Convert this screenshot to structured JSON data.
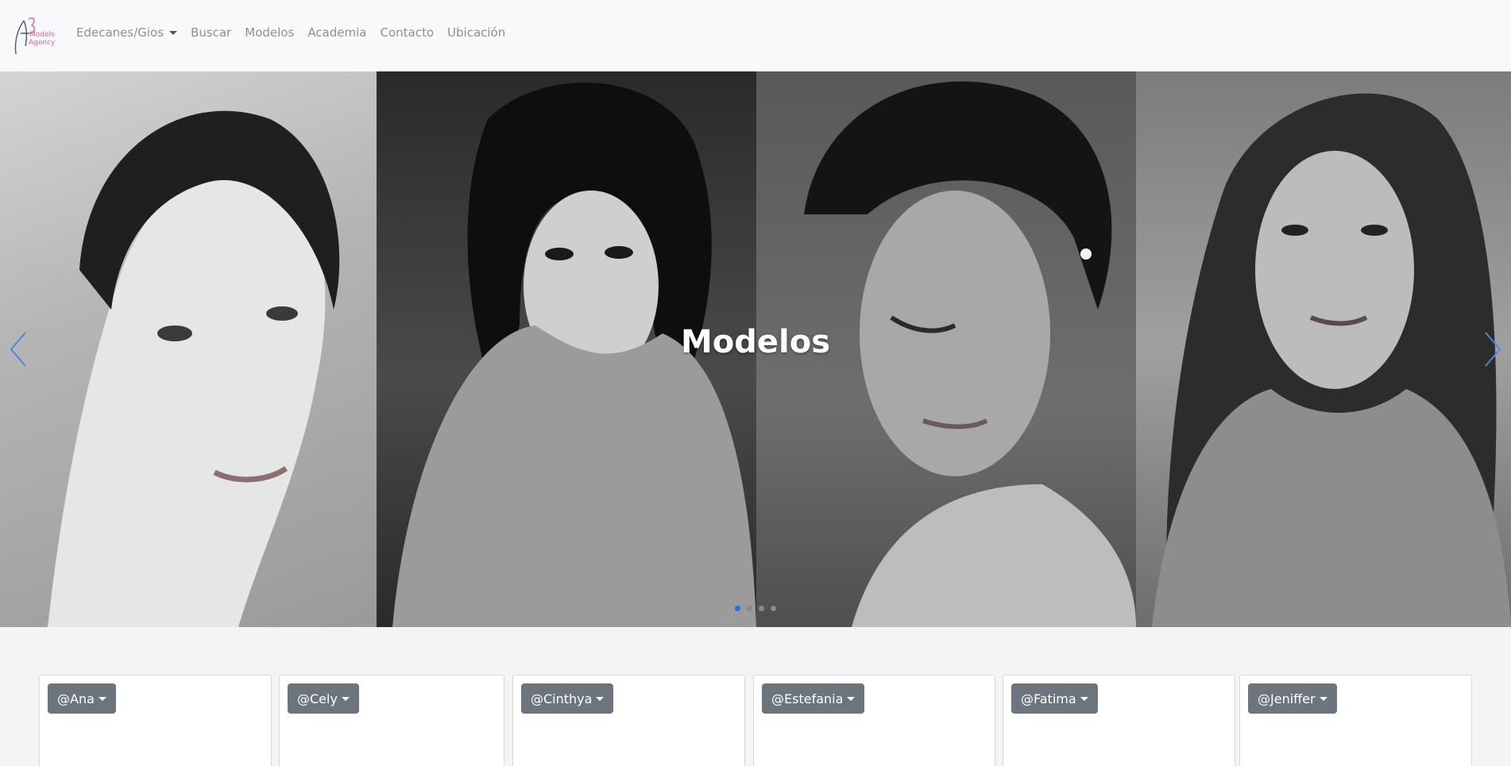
{
  "brand": {
    "logo_text_line1": "Models",
    "logo_text_line2": "Agency",
    "accent_color": "#e3608f"
  },
  "nav": {
    "items": [
      {
        "label": "Edecanes/Gios",
        "dropdown": true
      },
      {
        "label": "Buscar"
      },
      {
        "label": "Modelos"
      },
      {
        "label": "Academia"
      },
      {
        "label": "Contacto"
      },
      {
        "label": "Ubicación"
      }
    ]
  },
  "carousel": {
    "caption": "Modelos",
    "prev_icon": "chevron-left-icon",
    "next_icon": "chevron-right-icon",
    "slide_count": 4,
    "active_slide": 1,
    "indicator_active_color": "#1a73e8"
  },
  "models": [
    {
      "handle": "@Ana"
    },
    {
      "handle": "@Cely"
    },
    {
      "handle": "@Cinthya"
    },
    {
      "handle": "@Estefania"
    },
    {
      "handle": "@Fatima"
    },
    {
      "handle": "@Jeniffer"
    }
  ]
}
